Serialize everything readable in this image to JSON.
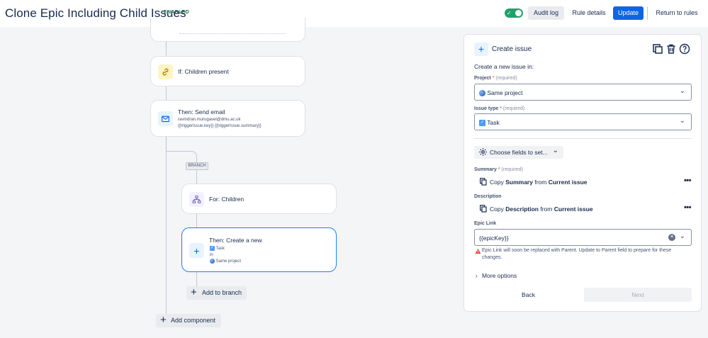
{
  "header": {
    "title": "Clone Epic Including Child Issues",
    "status_badge": "ENABLED",
    "audit_log": "Audit log",
    "rule_details": "Rule details",
    "update": "Update",
    "return_to_rules": "Return to rules"
  },
  "flow": {
    "condition": {
      "title": "If: Children present"
    },
    "email": {
      "title": "Then: Send email",
      "recipient": "ravindran.murugavel@dmu.ac.uk",
      "subject": "{{triggerIssue.key}} {{triggerIssue.summary}}"
    },
    "branch_tag": "BRANCH",
    "for_children": {
      "title": "For: Children"
    },
    "create_action": {
      "title": "Then: Create a new",
      "issue_type": "Task",
      "in_label": "in",
      "project": "Same project"
    },
    "add_to_branch": "Add to branch",
    "add_component": "Add component"
  },
  "panel": {
    "title": "Create issue",
    "intro": "Create a new issue in:",
    "project": {
      "label": "Project",
      "required_mark": "*",
      "required_text": "(required)",
      "value": "Same project"
    },
    "issue_type": {
      "label": "Issue type",
      "required_mark": "*",
      "required_text": "(required)",
      "value": "Task"
    },
    "choose_fields": "Choose fields to set...",
    "summary": {
      "label": "Summary",
      "required_mark": "*",
      "required_text": "(required)",
      "copy": "Copy",
      "field": "Summary",
      "from": "from",
      "source": "Current issue"
    },
    "description": {
      "label": "Description",
      "copy": "Copy",
      "field": "Description",
      "from": "from",
      "source": "Current issue"
    },
    "epic_link": {
      "label": "Epic Link",
      "value": "{{epicKey}}",
      "warning": "Epic Link will soon be replaced with Parent. Update to Parent field to prepare for these changes."
    },
    "more_options": "More options",
    "back": "Back",
    "next": "Next"
  },
  "colors": {
    "primary": "#0c66e4",
    "enabled": "#216e4e",
    "toggle_on": "#22a06b",
    "selected_border": "#1d7afc",
    "warning": "#e2483d"
  }
}
